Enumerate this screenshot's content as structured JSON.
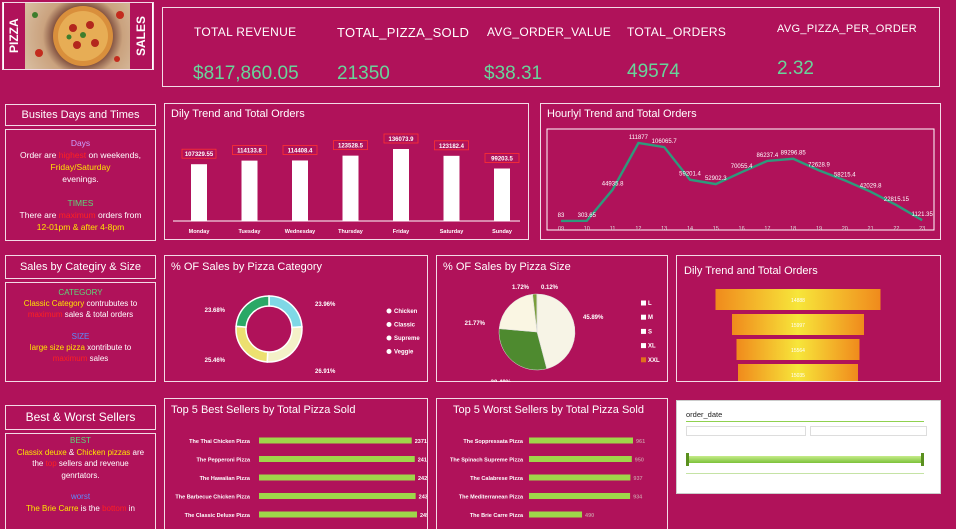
{
  "header": {
    "left_label": "PIZZA",
    "right_label": "SALES"
  },
  "kpis": [
    {
      "label": "TOTAL REVENUE",
      "value": "$817,860.05"
    },
    {
      "label": "TOTAL_PIZZA_SOLD",
      "value": "21350"
    },
    {
      "label": "AVG_ORDER_VALUE",
      "value": "$38.31"
    },
    {
      "label": "TOTAL_ORDERS",
      "value": "49574"
    },
    {
      "label": "AVG_PIZZA_PER_ORDER",
      "value": "2.32"
    }
  ],
  "busiest": {
    "title": "Busites Days and Times",
    "days_heading": "Days",
    "days_1a": "Order are ",
    "days_1b": "highest",
    "days_1c": " on weekends,",
    "days_2": "Friday/Saturday",
    "days_3": "evenings.",
    "times_heading": "TIMES",
    "times_1a": "There are ",
    "times_1b": "maximum",
    "times_1c": " orders from",
    "times_2": "12-01pm & after 4-8pm"
  },
  "category_size": {
    "title": "Sales by Categiry & Size",
    "cat_heading": "CATEGORY",
    "cat_1a": "Classic Category",
    "cat_1b": " contrubutes to",
    "cat_2a": "maximum",
    "cat_2b": " sales & total orders",
    "size_heading": "SIZE",
    "size_1a": "large size pizza",
    "size_1b": " xontribute to",
    "size_2a": "maximum",
    "size_2b": " sales"
  },
  "best_worst": {
    "title": "Best & Worst Sellers",
    "best_heading": "BEST",
    "best_1a": "Classix deuxe",
    "best_1b": " & ",
    "best_1c": "Chicken pizzas",
    "best_1d": " are",
    "best_2a": "the ",
    "best_2b": "top",
    "best_2c": " sellers and revenue",
    "best_3": "genrtators.",
    "worst_heading": "worst",
    "worst_1a": "The Brie Carre",
    "worst_1b": " is the ",
    "worst_1c": "bottom",
    "worst_1d": " in"
  },
  "daily_chart": {
    "title": "Dily Trend and Total Orders",
    "chart_data": {
      "type": "bar",
      "categories": [
        "Monday",
        "Tuesday",
        "Wednesday",
        "Thursday",
        "Friday",
        "Saturday",
        "Sunday"
      ],
      "values": [
        107329.55,
        114133.8,
        114408.4,
        123528.5,
        136073.9,
        123182.4,
        99203.5
      ],
      "labels": [
        "107329.55",
        "114133.8",
        "114408.4",
        "123528.5",
        "136073.9",
        "123182.4",
        "99203.5"
      ]
    }
  },
  "hourly_chart": {
    "title": "Hourlyl Trend and Total Orders",
    "chart_data": {
      "type": "line",
      "x": [
        "09",
        "10",
        "11",
        "12",
        "13",
        "14",
        "15",
        "16",
        "17",
        "18",
        "19",
        "20",
        "21",
        "22",
        "23"
      ],
      "values": [
        83,
        303.65,
        44935.8,
        111877,
        106065.7,
        59201.4,
        52902.3,
        70055.4,
        86237.4,
        89296.85,
        72628.9,
        58215.4,
        42029.8,
        22815.15,
        1121.35
      ],
      "labels": [
        "83",
        "303.65",
        "44935.8",
        "111877",
        "106065.7",
        "59201.4",
        "52902.3",
        "70055.4",
        "86237.4",
        "89296.85",
        "72628.9",
        "58215.4",
        "42029.8",
        "22815.15",
        "1121.35"
      ]
    }
  },
  "category_chart": {
    "title": "% OF Sales  by Pizza Category",
    "chart_data": {
      "type": "pie",
      "categories": [
        "Chicken",
        "Classic",
        "Supreme",
        "Veggie"
      ],
      "values": [
        23.96,
        26.91,
        25.46,
        23.68
      ],
      "labels": [
        "23.96%",
        "26.91%",
        "25.46%",
        "23.68%"
      ],
      "colors": [
        "#7fd8e6",
        "#f4f1c8",
        "#ece070",
        "#2aa866"
      ]
    }
  },
  "size_chart": {
    "title": "% OF Sales  by Pizza Size",
    "chart_data": {
      "type": "pie",
      "categories": [
        "L",
        "M",
        "S",
        "XL",
        "XXL"
      ],
      "values": [
        45.89,
        30.49,
        21.77,
        1.72,
        0.12
      ],
      "labels": [
        "45.89%",
        "30.49%",
        "21.77%",
        "1.72%",
        "0.12%"
      ],
      "colors": [
        "#f7f4e6",
        "#4e8a2f",
        "#faf6e3",
        "#7a9e3a",
        "#e0701d"
      ]
    }
  },
  "funnel_chart": {
    "title": "Dily Trend and Total Orders",
    "chart_data": {
      "type": "bar",
      "values": [
        14888,
        15997,
        15564,
        15035
      ],
      "labels": [
        "14888",
        "15997",
        "15564",
        "15035"
      ]
    }
  },
  "best_chart": {
    "title": "Top 5 Best Sellers by Total Pizza Sold",
    "chart_data": {
      "type": "bar",
      "categories": [
        "The Thai Chicken Pizza",
        "The Pepperoni Pizza",
        "The Hawaiian Pizza",
        "The Barbecue Chicken Pizza",
        "The Classic Deluxe Pizza"
      ],
      "values": [
        2371,
        2418,
        2422,
        2432,
        2453
      ],
      "labels": [
        "2371",
        "2418",
        "2422",
        "2432",
        "2453"
      ]
    }
  },
  "worst_chart": {
    "title": "Top 5 Worst Sellers by Total Pizza Sold",
    "chart_data": {
      "type": "bar",
      "categories": [
        "The Soppressata Pizza",
        "The Spinach Supreme Pizza",
        "The Calabrese Pizza",
        "The Mediterranean Pizza",
        "The Brie Carre Pizza"
      ],
      "values": [
        961,
        950,
        937,
        934,
        490
      ],
      "labels": [
        "961",
        "950",
        "937",
        "934",
        "490"
      ]
    }
  },
  "slicer": {
    "label": "order_date"
  }
}
